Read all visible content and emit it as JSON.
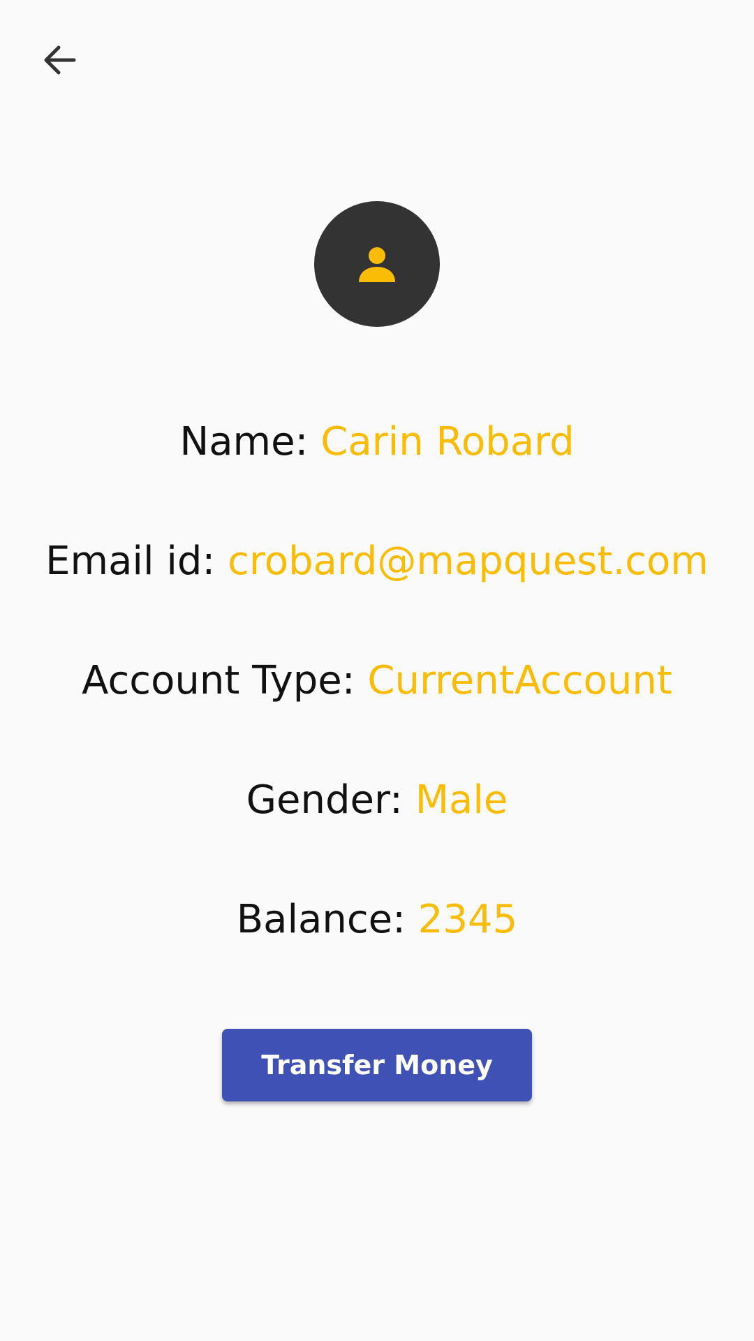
{
  "header": {
    "back_icon": "arrow-left-icon"
  },
  "avatar": {
    "icon": "person-icon",
    "background_color": "#333333",
    "icon_color": "#fbbc05"
  },
  "details": {
    "name_label": "Name: ",
    "name_value": "Carin Robard",
    "email_label": "Email id: ",
    "email_value": "crobard@mapquest.com",
    "account_type_label": "Account Type: ",
    "account_type_value": "CurrentAccount",
    "gender_label": "Gender: ",
    "gender_value": "Male",
    "balance_label": "Balance: ",
    "balance_value": "2345"
  },
  "actions": {
    "transfer_label": "Transfer Money"
  },
  "colors": {
    "accent": "#fbbc05",
    "primary": "#3f51b5",
    "background": "#fafafa"
  }
}
